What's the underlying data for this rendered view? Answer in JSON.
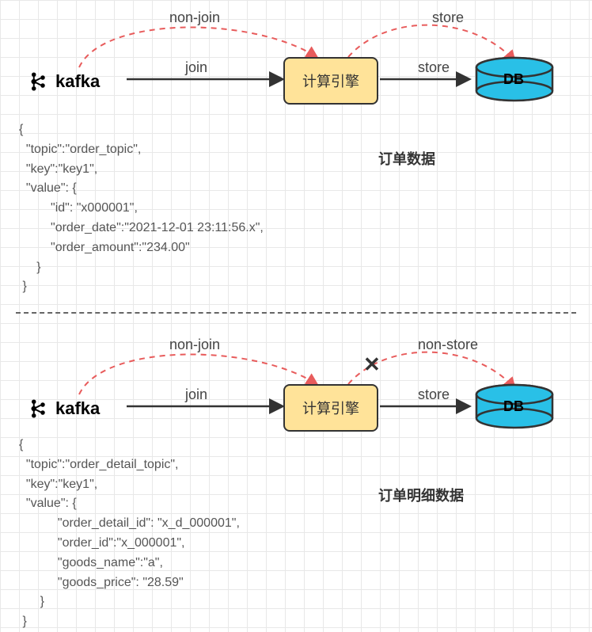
{
  "top": {
    "kafka_label": "kafka",
    "engine_label": "计算引擎",
    "db_label": "DB",
    "arrow_join": "join",
    "arrow_store": "store",
    "arc_non_join": "non-join",
    "arc_store": "store",
    "section_title": "订单数据",
    "json_text": "{\n  \"topic\":\"order_topic\",\n  \"key\":\"key1\",\n  \"value\": {\n         \"id\": \"x000001\",\n         \"order_date\":\"2021-12-01 23:11:56.x\",\n         \"order_amount\":\"234.00\"\n     }\n }"
  },
  "bottom": {
    "kafka_label": "kafka",
    "engine_label": "计算引擎",
    "db_label": "DB",
    "arrow_join": "join",
    "arrow_store": "store",
    "arc_non_join": "non-join",
    "arc_non_store": "non-store",
    "x_mark": "✕",
    "section_title": "订单明细数据",
    "json_text": "{\n  \"topic\":\"order_detail_topic\",\n  \"key\":\"key1\",\n  \"value\": {\n           \"order_detail_id\": \"x_d_000001\",\n           \"order_id\":\"x_000001\",\n           \"goods_name\":\"a\",\n           \"goods_price\": \"28.59\"\n      }\n }"
  },
  "colors": {
    "engine_fill": "#ffe399",
    "db_fill": "#29c0e7",
    "dashed_red": "#e85c5c"
  }
}
